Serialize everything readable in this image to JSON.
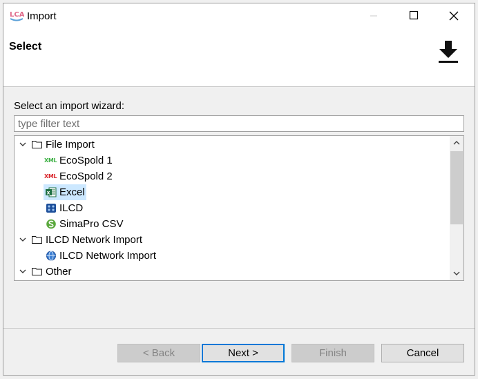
{
  "window": {
    "title": "Import",
    "app_icon_text": "LCA"
  },
  "banner": {
    "title": "Select",
    "icon": "download-icon"
  },
  "wizard": {
    "label": "Select an import wizard:",
    "filter_placeholder": "type filter text",
    "filter_value": ""
  },
  "tree": {
    "groups": [
      {
        "label": "File Import",
        "expanded": true,
        "items": [
          {
            "label": "EcoSpold 1",
            "icon": "xml-green-icon",
            "icon_text": "XML"
          },
          {
            "label": "EcoSpold 2",
            "icon": "xml-red-icon",
            "icon_text": "XML"
          },
          {
            "label": "Excel",
            "icon": "excel-icon",
            "selected": true
          },
          {
            "label": "ILCD",
            "icon": "ilcd-icon"
          },
          {
            "label": "SimaPro CSV",
            "icon": "simapro-icon"
          }
        ]
      },
      {
        "label": "ILCD Network Import",
        "expanded": true,
        "items": [
          {
            "label": "ILCD Network Import",
            "icon": "globe-icon"
          }
        ]
      },
      {
        "label": "Other",
        "expanded": true,
        "items": []
      }
    ]
  },
  "buttons": {
    "back": "< Back",
    "next": "Next >",
    "finish": "Finish",
    "cancel": "Cancel"
  },
  "colors": {
    "selection": "#cce8ff",
    "default_button_border": "#0078d7"
  }
}
